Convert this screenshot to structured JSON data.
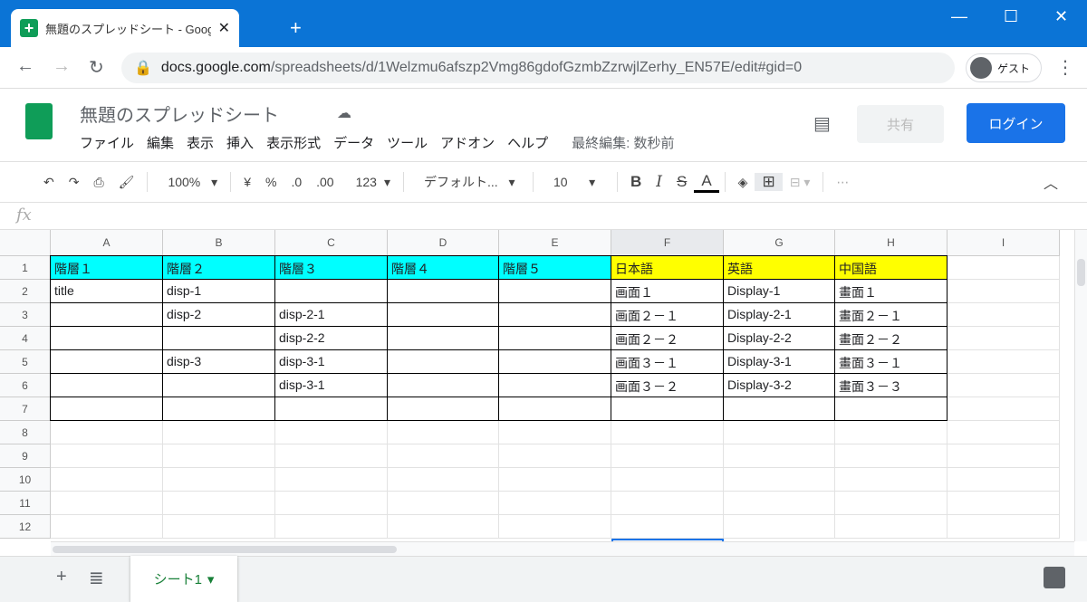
{
  "browser": {
    "tab_title": "無題のスプレッドシート - Google スプ",
    "url_host": "docs.google.com",
    "url_path": "/spreadsheets/d/1Welzmu6afszp2Vmg86gdofGzmbZzrwjlZerhy_EN57E/edit#gid=0",
    "guest_label": "ゲスト"
  },
  "doc": {
    "title": "無題のスプレッドシート",
    "menu": [
      "ファイル",
      "編集",
      "表示",
      "挿入",
      "表示形式",
      "データ",
      "ツール",
      "アドオン",
      "ヘルプ"
    ],
    "last_edit": "最終編集: 数秒前",
    "share_label": "共有",
    "login_label": "ログイン"
  },
  "toolbar": {
    "zoom": "100%",
    "currency": "¥",
    "percent": "%",
    "dec_less": ".0",
    "dec_more": ".00",
    "format": "123",
    "font": "デフォルト...",
    "font_size": "10",
    "bold": "B",
    "italic": "I",
    "strike": "S",
    "text_color": "A",
    "more": "⋯"
  },
  "formula_bar": {
    "fx": "fx",
    "value": ""
  },
  "columns": [
    "A",
    "B",
    "C",
    "D",
    "E",
    "F",
    "G",
    "H",
    "I"
  ],
  "rows": [
    "1",
    "2",
    "3",
    "4",
    "5",
    "6",
    "7",
    "8",
    "9",
    "10",
    "11",
    "12"
  ],
  "cells": [
    [
      "階層１",
      "階層２",
      "階層３",
      "階層４",
      "階層５",
      "日本語",
      "英語",
      "中国語",
      ""
    ],
    [
      "title",
      "disp-1",
      "",
      "",
      "",
      "画面１",
      "Display-1",
      "畫面１",
      ""
    ],
    [
      "",
      "disp-2",
      "disp-2-1",
      "",
      "",
      "画面２－１",
      "Display-2-1",
      "畫面２－１",
      ""
    ],
    [
      "",
      "",
      "disp-2-2",
      "",
      "",
      "画面２－２",
      "Display-2-2",
      "畫面２－２",
      ""
    ],
    [
      "",
      "disp-3",
      "disp-3-1",
      "",
      "",
      "画面３－１",
      "Display-3-1",
      "畫面３－１",
      ""
    ],
    [
      "",
      "",
      "disp-3-1",
      "",
      "",
      "画面３－２",
      "Display-3-2",
      "畫面３－３",
      ""
    ],
    [
      "",
      "",
      "",
      "",
      "",
      "",
      "",
      "",
      ""
    ]
  ],
  "colors": {
    "header_cyan": "#00ffff",
    "header_yellow": "#ffff00",
    "accent": "#1a73e8",
    "sheets_green": "#0f9d58"
  },
  "sheets": [
    {
      "name": "シート1"
    }
  ]
}
